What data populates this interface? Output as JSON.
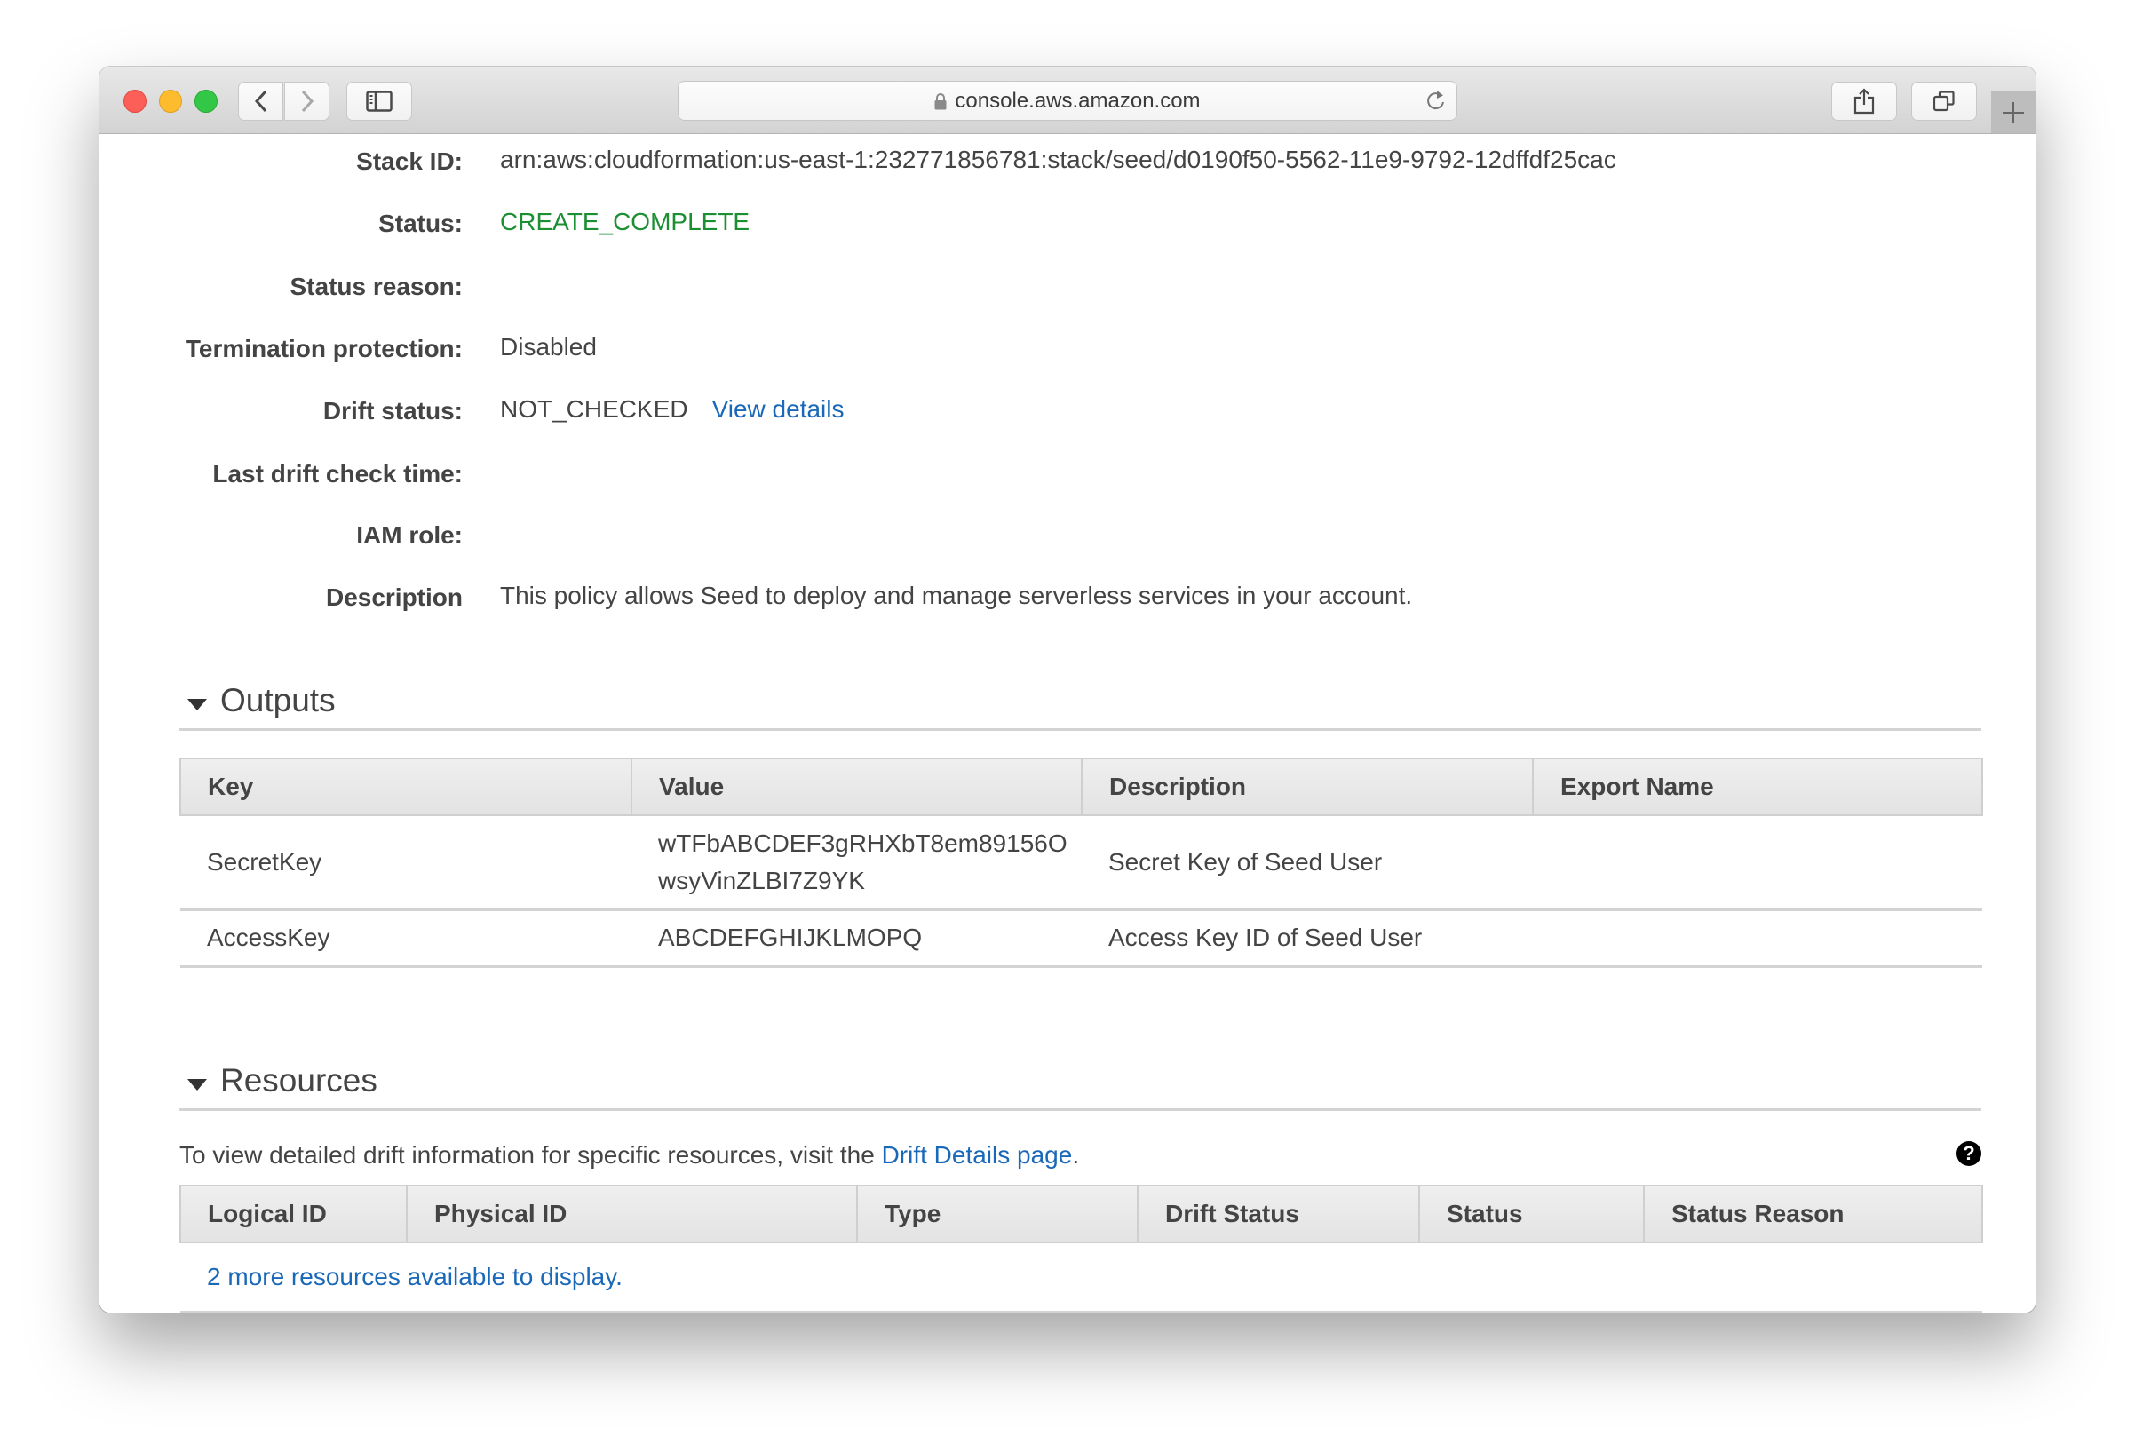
{
  "browser": {
    "url": "console.aws.amazon.com",
    "buttons": {
      "back": "back",
      "forward": "forward",
      "sidebar": "sidebar",
      "share": "share",
      "tabs": "tabs",
      "new_tab": "new tab"
    }
  },
  "details": [
    {
      "label": "Stack ID:",
      "value": "arn:aws:cloudformation:us-east-1:232771856781:stack/seed/d0190f50-5562-11e9-9792-12dffdf25cac"
    },
    {
      "label": "Status:",
      "value": "CREATE_COMPLETE",
      "color": "#1d8f33"
    },
    {
      "label": "Status reason:",
      "value": ""
    },
    {
      "label": "Termination protection:",
      "value": "Disabled"
    },
    {
      "label": "Drift status:",
      "value": "NOT_CHECKED",
      "link": "View details"
    },
    {
      "label": "Last drift check time:",
      "value": ""
    },
    {
      "label": "IAM role:",
      "value": ""
    },
    {
      "label": "Description",
      "value": "This policy allows Seed to deploy and manage serverless services in your account."
    }
  ],
  "outputs": {
    "title": "Outputs",
    "columns": [
      "Key",
      "Value",
      "Description",
      "Export Name"
    ],
    "rows": [
      {
        "key": "SecretKey",
        "value_line1": "wTFbABCDEF3gRHXbT8em89156O",
        "value_line2": "wsyVinZLBI7Z9YK",
        "description": "Secret Key of Seed User",
        "export_name": ""
      },
      {
        "key": "AccessKey",
        "value_line1": "ABCDEFGHIJKLMOPQ",
        "value_line2": "",
        "description": "Access Key ID of Seed User",
        "export_name": ""
      }
    ]
  },
  "resources": {
    "title": "Resources",
    "info_prefix": "To view detailed drift information for specific resources, visit the ",
    "info_link": "Drift Details page",
    "info_suffix": ".",
    "help": "?",
    "columns": [
      "Logical ID",
      "Physical ID",
      "Type",
      "Drift Status",
      "Status",
      "Status Reason"
    ],
    "more_link": "2 more resources available to display."
  },
  "colors": {
    "status_green": "#1d8f33",
    "link_blue": "#1a68b8",
    "text": "#444444"
  }
}
